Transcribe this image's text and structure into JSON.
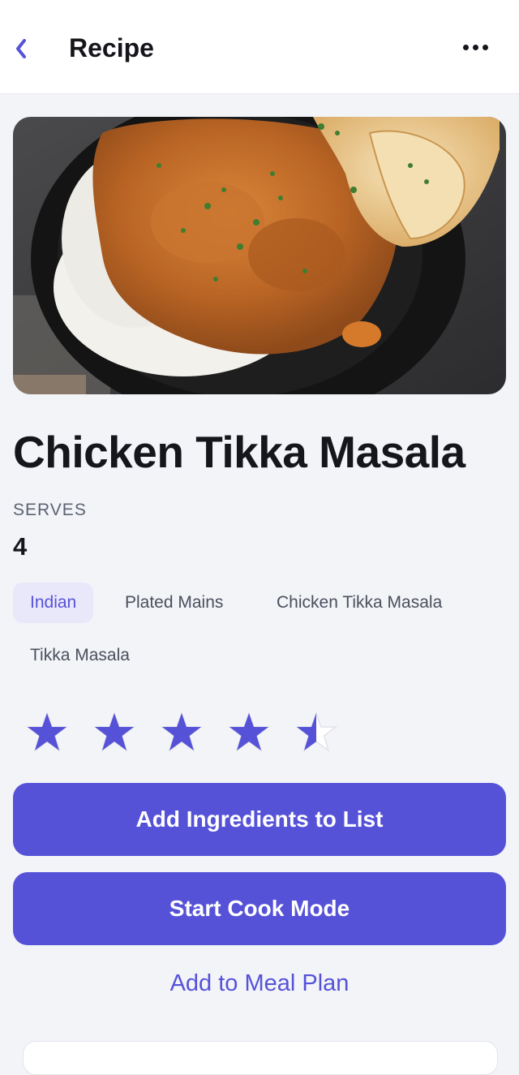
{
  "header": {
    "title": "Recipe",
    "back_icon": "chevron-left-icon",
    "more_icon": "more-horizontal-icon"
  },
  "recipe": {
    "image_alt": "Chicken tikka masala with rice and naan",
    "name": "Chicken Tikka Masala",
    "serves_label": "SERVES",
    "serves_value": "4",
    "tags": [
      "Indian",
      "Plated Mains",
      "Chicken Tikka Masala",
      "Tikka Masala"
    ],
    "rating": 4.5,
    "rating_max": 5
  },
  "actions": {
    "add_ingredients": "Add Ingredients to List",
    "start_cook": "Start Cook Mode",
    "add_meal_plan": "Add to Meal Plan"
  },
  "colors": {
    "accent": "#5652d8",
    "background": "#f2f4f8",
    "tag_active_bg": "#e9e8fb",
    "text": "#15151c"
  }
}
